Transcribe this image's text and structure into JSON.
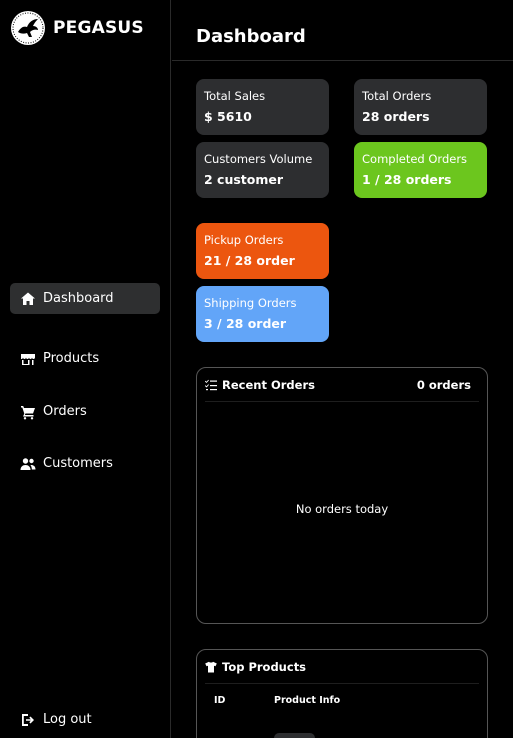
{
  "brand": {
    "name": "PEGASUS"
  },
  "sidebar": {
    "items": [
      {
        "label": "Dashboard",
        "icon": "home-icon",
        "active": true
      },
      {
        "label": "Products",
        "icon": "store-icon"
      },
      {
        "label": "Orders",
        "icon": "cart-icon"
      },
      {
        "label": "Customers",
        "icon": "users-icon"
      }
    ],
    "logout": {
      "label": "Log out",
      "icon": "logout-icon"
    }
  },
  "header": {
    "title": "Dashboard"
  },
  "stats": {
    "total_sales": {
      "label": "Total Sales",
      "value": "$ 5610"
    },
    "total_orders": {
      "label": "Total Orders",
      "value": "28 orders"
    },
    "customers_volume": {
      "label": "Customers Volume",
      "value": "2 customer"
    },
    "completed_orders": {
      "label": "Completed Orders",
      "value": "1 / 28 orders"
    },
    "pickup_orders": {
      "label": "Pickup Orders",
      "value": "21 / 28 order"
    },
    "shipping_orders": {
      "label": "Shipping Orders",
      "value": "3 / 28 order"
    }
  },
  "colors": {
    "completed": "#6cc61e",
    "pickup": "#ec560f",
    "shipping": "#62a5f8",
    "card_dark": "#2d2e30"
  },
  "recent_orders": {
    "title": "Recent Orders",
    "count": "0 orders",
    "empty_message": "No orders today"
  },
  "top_products": {
    "title": "Top Products",
    "columns": [
      "ID",
      "Product Info"
    ]
  }
}
